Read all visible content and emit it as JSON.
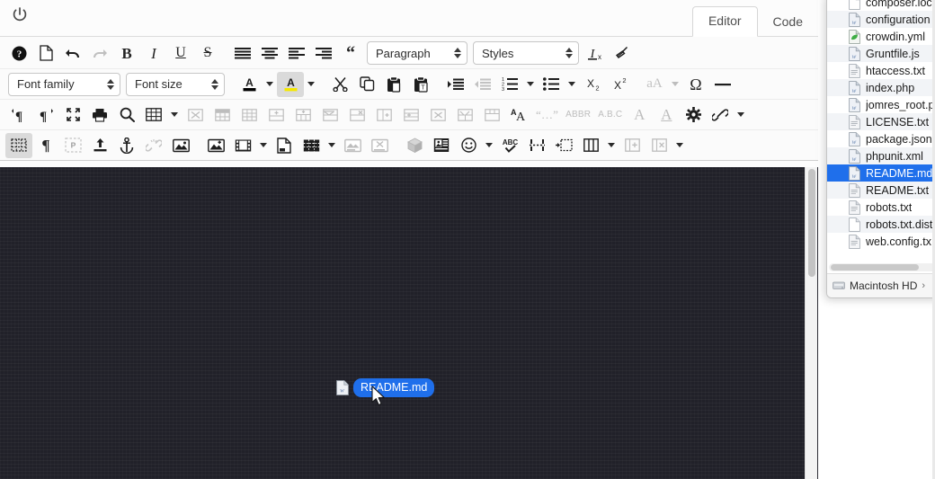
{
  "app": {
    "power_icon": "power-icon",
    "tabs": [
      {
        "label": "Editor",
        "active": true
      },
      {
        "label": "Code",
        "active": false
      }
    ]
  },
  "toolbar": {
    "row1": [
      {
        "name": "help",
        "glyph": "help-icon",
        "disabled": false
      },
      {
        "name": "new-document",
        "glyph": "new-document-icon",
        "disabled": false
      },
      {
        "name": "undo",
        "glyph": "undo-icon",
        "disabled": false
      },
      {
        "name": "redo",
        "glyph": "redo-icon",
        "disabled": true
      },
      {
        "name": "bold",
        "glyph": "bold-icon",
        "label": "B",
        "disabled": false
      },
      {
        "name": "italic",
        "glyph": "italic-icon",
        "label": "I",
        "disabled": false
      },
      {
        "name": "underline",
        "glyph": "underline-icon",
        "label": "U",
        "disabled": false
      },
      {
        "name": "strikethrough",
        "glyph": "strikethrough-icon",
        "label": "S",
        "disabled": false
      },
      {
        "name": "align-justify",
        "glyph": "align-justify-icon",
        "disabled": false
      },
      {
        "name": "align-center",
        "glyph": "align-center-icon",
        "disabled": false
      },
      {
        "name": "align-left",
        "glyph": "align-left-icon",
        "disabled": false
      },
      {
        "name": "align-right",
        "glyph": "align-right-icon",
        "disabled": false
      },
      {
        "name": "blockquote",
        "glyph": "blockquote-icon",
        "disabled": false
      }
    ],
    "paragraph_select": "Paragraph",
    "styles_select": "Styles",
    "row1_tail": [
      {
        "name": "remove-format",
        "glyph": "remove-format-icon",
        "disabled": false
      },
      {
        "name": "clear-formatting",
        "glyph": "broom-icon",
        "disabled": false
      }
    ],
    "font_family_select": "Font family",
    "font_size_select": "Font size",
    "row2": [
      {
        "name": "text-color",
        "glyph": "text-color-icon",
        "disabled": false,
        "active": false,
        "color": "#000000"
      },
      {
        "name": "background-color",
        "glyph": "background-color-icon",
        "disabled": false,
        "active": true,
        "color": "#f5e800"
      },
      {
        "name": "cut",
        "glyph": "scissors-icon",
        "disabled": false
      },
      {
        "name": "copy",
        "glyph": "copy-icon",
        "disabled": false
      },
      {
        "name": "paste",
        "glyph": "paste-icon",
        "disabled": false
      },
      {
        "name": "paste-as-text",
        "glyph": "paste-text-icon",
        "disabled": false
      },
      {
        "name": "indent",
        "glyph": "indent-icon",
        "disabled": false
      },
      {
        "name": "outdent",
        "glyph": "outdent-icon",
        "disabled": true
      },
      {
        "name": "numbered-list",
        "glyph": "numbered-list-icon",
        "disabled": false
      },
      {
        "name": "bullet-list",
        "glyph": "bullet-list-icon",
        "disabled": false
      },
      {
        "name": "subscript",
        "glyph": "subscript-icon",
        "disabled": false
      },
      {
        "name": "superscript",
        "glyph": "superscript-icon",
        "disabled": false
      },
      {
        "name": "text-case",
        "glyph": "text-case-icon",
        "label": "aA",
        "disabled": true
      },
      {
        "name": "special-character",
        "glyph": "omega-icon",
        "label": "Ω",
        "disabled": false
      },
      {
        "name": "horizontal-rule",
        "glyph": "horizontal-rule-icon",
        "disabled": false
      }
    ],
    "row3": [
      {
        "name": "ltr-paragraph",
        "glyph": "ltr-paragraph-icon",
        "disabled": false
      },
      {
        "name": "rtl-paragraph",
        "glyph": "rtl-paragraph-icon",
        "disabled": false
      },
      {
        "name": "fullscreen",
        "glyph": "fullscreen-icon",
        "disabled": false
      },
      {
        "name": "print",
        "glyph": "printer-icon",
        "disabled": false
      },
      {
        "name": "search",
        "glyph": "search-icon",
        "disabled": false
      },
      {
        "name": "insert-table",
        "glyph": "table-icon",
        "disabled": false
      },
      {
        "name": "delete-table",
        "glyph": "table-delete-icon",
        "disabled": true
      },
      {
        "name": "table-properties",
        "glyph": "table-properties-icon",
        "disabled": true
      },
      {
        "name": "table-row-properties",
        "glyph": "table-row-props-icon",
        "disabled": true
      },
      {
        "name": "table-cell-properties",
        "glyph": "table-cell-props-icon",
        "disabled": true
      },
      {
        "name": "insert-row-before",
        "glyph": "row-insert-before-icon",
        "disabled": true
      },
      {
        "name": "insert-row-after",
        "glyph": "row-insert-after-icon",
        "disabled": true
      },
      {
        "name": "delete-row",
        "glyph": "row-delete-icon",
        "disabled": true
      },
      {
        "name": "insert-column-before",
        "glyph": "col-insert-before-icon",
        "disabled": true
      },
      {
        "name": "insert-column-after",
        "glyph": "col-insert-after-icon",
        "disabled": true
      },
      {
        "name": "delete-column",
        "glyph": "col-delete-icon",
        "disabled": true
      },
      {
        "name": "merge-cells",
        "glyph": "merge-cells-icon",
        "disabled": true
      },
      {
        "name": "split-cell",
        "glyph": "split-cell-icon",
        "disabled": true
      },
      {
        "name": "font-select",
        "glyph": "font-aa-icon",
        "disabled": false
      },
      {
        "name": "quote",
        "glyph": "quote-dots-icon",
        "disabled": true
      },
      {
        "name": "abbreviation",
        "glyph": "abbr-icon",
        "label": "ABBR",
        "disabled": true
      },
      {
        "name": "acronym",
        "glyph": "acronym-icon",
        "label": "A.B.C",
        "disabled": true
      },
      {
        "name": "cite",
        "glyph": "cite-icon",
        "label": "A",
        "disabled": true
      },
      {
        "name": "insert-definition",
        "glyph": "ins-icon",
        "label": "A",
        "disabled": true
      },
      {
        "name": "settings",
        "glyph": "gear-icon",
        "disabled": false
      },
      {
        "name": "insert-link",
        "glyph": "link-icon",
        "disabled": false
      }
    ],
    "row4": [
      {
        "name": "show-borders",
        "glyph": "show-borders-icon",
        "disabled": false,
        "active": true
      },
      {
        "name": "show-invisible-characters",
        "glyph": "pilcrow-icon",
        "disabled": false
      },
      {
        "name": "visual-blocks",
        "glyph": "visual-blocks-icon",
        "label": "P",
        "disabled": true
      },
      {
        "name": "insert-file",
        "glyph": "upload-icon",
        "disabled": false
      },
      {
        "name": "anchor",
        "glyph": "anchor-icon",
        "disabled": false
      },
      {
        "name": "unlink",
        "glyph": "unlink-icon",
        "disabled": true
      },
      {
        "name": "insert-image",
        "glyph": "image-icon",
        "disabled": false
      },
      {
        "name": "edit-image",
        "glyph": "image-add-icon",
        "disabled": false
      },
      {
        "name": "insert-media",
        "glyph": "film-icon",
        "disabled": false
      },
      {
        "name": "insert-page",
        "glyph": "page-icon",
        "disabled": false
      },
      {
        "name": "insert-template",
        "glyph": "template-grid-icon",
        "disabled": false
      },
      {
        "name": "image-map",
        "glyph": "image-map-icon",
        "disabled": true
      },
      {
        "name": "remove-image",
        "glyph": "image-remove-icon",
        "disabled": true
      },
      {
        "name": "insert-3d-object",
        "glyph": "cube-icon",
        "disabled": true
      },
      {
        "name": "insert-media-card",
        "glyph": "media-card-icon",
        "disabled": false
      },
      {
        "name": "emoticons",
        "glyph": "smiley-icon",
        "disabled": false
      },
      {
        "name": "spellcheck",
        "glyph": "spellcheck-icon",
        "label": "ABC",
        "disabled": false
      },
      {
        "name": "page-break",
        "glyph": "page-break-icon",
        "disabled": false
      },
      {
        "name": "insert-region",
        "glyph": "insert-region-icon",
        "disabled": false
      },
      {
        "name": "columns",
        "glyph": "columns-icon",
        "disabled": false
      },
      {
        "name": "add-column",
        "glyph": "column-add-icon",
        "disabled": true
      },
      {
        "name": "remove-column",
        "glyph": "column-remove-icon",
        "disabled": true
      }
    ]
  },
  "canvas": {
    "drag_chip": {
      "filename": "README.md",
      "file_icon": "markdown-file-icon",
      "cursor": "arrow-cursor"
    }
  },
  "finder": {
    "files": [
      {
        "name": "composer.loc",
        "icon": "plain-file-icon",
        "selected": false
      },
      {
        "name": "configuration",
        "icon": "php-file-icon",
        "selected": false
      },
      {
        "name": "crowdin.yml",
        "icon": "leaf-file-icon",
        "selected": false
      },
      {
        "name": "Gruntfile.js",
        "icon": "php-file-icon",
        "selected": false
      },
      {
        "name": "htaccess.txt",
        "icon": "text-file-icon",
        "selected": false
      },
      {
        "name": "index.php",
        "icon": "php-file-icon",
        "selected": false
      },
      {
        "name": "jomres_root.p",
        "icon": "php-file-icon",
        "selected": false
      },
      {
        "name": "LICENSE.txt",
        "icon": "text-file-icon",
        "selected": false
      },
      {
        "name": "package.json",
        "icon": "php-file-icon",
        "selected": false
      },
      {
        "name": "phpunit.xml",
        "icon": "php-file-icon",
        "selected": false
      },
      {
        "name": "README.md",
        "icon": "php-file-icon",
        "selected": true
      },
      {
        "name": "README.txt",
        "icon": "text-file-icon",
        "selected": false
      },
      {
        "name": "robots.txt",
        "icon": "text-file-icon",
        "selected": false
      },
      {
        "name": "robots.txt.dist",
        "icon": "plain-file-icon",
        "selected": false
      },
      {
        "name": "web.config.tx",
        "icon": "text-file-icon",
        "selected": false
      }
    ],
    "path_bar": {
      "volume": "Macintosh HD",
      "separator": "›",
      "volume_icon": "hard-drive-icon"
    }
  },
  "colors": {
    "selection_blue": "#1f6feb",
    "canvas_background": "#212129",
    "highlight_yellow": "#f5e800",
    "toolbar_background": "#fbfbfb"
  }
}
